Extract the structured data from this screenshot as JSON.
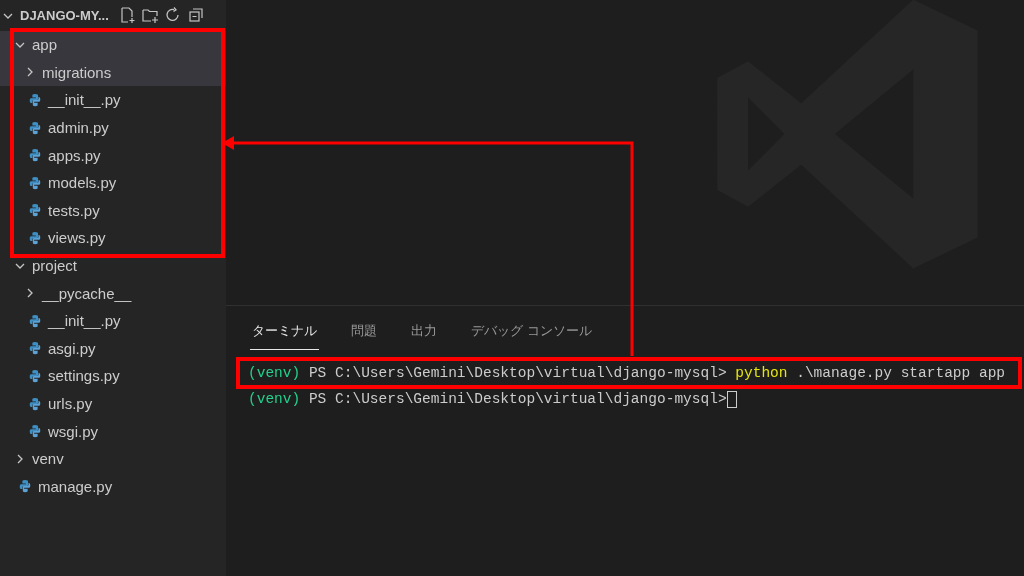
{
  "explorer": {
    "title": "DJANGO-MY...",
    "expanded": true,
    "tree": [
      {
        "kind": "folder",
        "label": "app",
        "expanded": true,
        "selected": true,
        "children": [
          {
            "kind": "folder",
            "label": "migrations",
            "expanded": false,
            "selected": true
          },
          {
            "kind": "file",
            "label": "__init__.py",
            "selected": false
          },
          {
            "kind": "file",
            "label": "admin.py",
            "selected": false
          },
          {
            "kind": "file",
            "label": "apps.py",
            "selected": false
          },
          {
            "kind": "file",
            "label": "models.py",
            "selected": false
          },
          {
            "kind": "file",
            "label": "tests.py",
            "selected": false
          },
          {
            "kind": "file",
            "label": "views.py",
            "selected": false
          }
        ]
      },
      {
        "kind": "folder",
        "label": "project",
        "expanded": true,
        "selected": false,
        "children": [
          {
            "kind": "folder",
            "label": "__pycache__",
            "expanded": false,
            "selected": false
          },
          {
            "kind": "file",
            "label": "__init__.py",
            "selected": false
          },
          {
            "kind": "file",
            "label": "asgi.py",
            "selected": false
          },
          {
            "kind": "file",
            "label": "settings.py",
            "selected": false
          },
          {
            "kind": "file",
            "label": "urls.py",
            "selected": false
          },
          {
            "kind": "file",
            "label": "wsgi.py",
            "selected": false
          }
        ]
      },
      {
        "kind": "folder",
        "label": "venv",
        "expanded": false,
        "selected": false
      },
      {
        "kind": "file",
        "label": "manage.py",
        "selected": false
      }
    ]
  },
  "panel": {
    "tabs": [
      {
        "label": "ターミナル",
        "selected": true
      },
      {
        "label": "問題",
        "selected": false
      },
      {
        "label": "出力",
        "selected": false
      },
      {
        "label": "デバッグ コンソール",
        "selected": false
      }
    ],
    "terminal_lines": [
      {
        "highlighted": true,
        "cursor": false,
        "segments": [
          {
            "kind": "env",
            "text": "(venv)"
          },
          {
            "kind": "plain",
            "text": "PS C:\\Users\\Gemini\\Desktop\\virtual\\django-mysql>"
          },
          {
            "kind": "command",
            "text": "python"
          },
          {
            "kind": "plain",
            "text": ".\\manage.py startapp app"
          }
        ]
      },
      {
        "highlighted": false,
        "cursor": true,
        "segments": [
          {
            "kind": "env",
            "text": "(venv)"
          },
          {
            "kind": "plain",
            "text": "PS C:\\Users\\Gemini\\Desktop\\virtual\\django-mysql>"
          }
        ]
      }
    ]
  }
}
